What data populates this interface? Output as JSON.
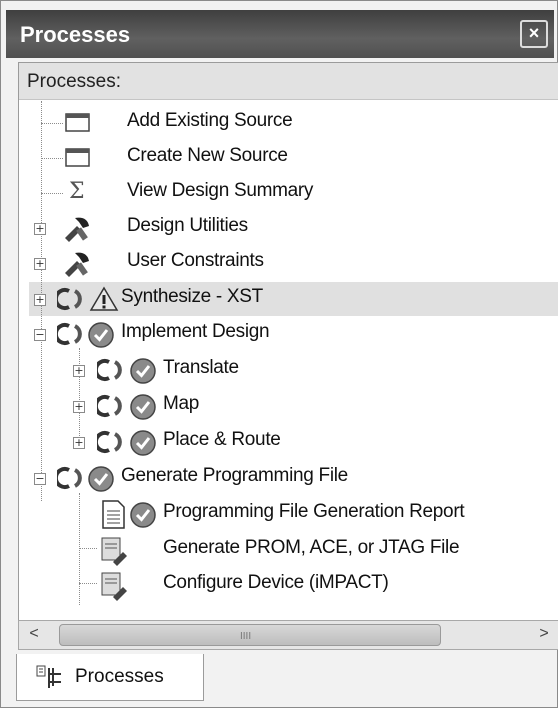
{
  "window": {
    "title": "Processes",
    "close_glyph": "×"
  },
  "panel": {
    "header": "Processes:"
  },
  "items": [
    {
      "label": "Add Existing Source",
      "icon": "window-icon"
    },
    {
      "label": "Create New Source",
      "icon": "window-icon"
    },
    {
      "label": "View Design Summary",
      "icon": "sigma-icon"
    },
    {
      "label": "Design Utilities",
      "icon": "tools-icon"
    },
    {
      "label": "User Constraints",
      "icon": "tools-icon"
    },
    {
      "label": "Synthesize - XST",
      "icon": "warning-icon",
      "selected": true
    },
    {
      "label": "Implement Design",
      "icon": "check-icon"
    },
    {
      "label": "Translate",
      "icon": "check-icon"
    },
    {
      "label": "Map",
      "icon": "check-icon"
    },
    {
      "label": "Place & Route",
      "icon": "check-icon"
    },
    {
      "label": "Generate Programming File",
      "icon": "check-icon"
    },
    {
      "label": "Programming File Generation Report",
      "icon": "report-check-icon"
    },
    {
      "label": "Generate PROM, ACE, or JTAG File",
      "icon": "tools-icon"
    },
    {
      "label": "Configure Device (iMPACT)",
      "icon": "tools-icon"
    }
  ],
  "scrollbar": {
    "left": "<",
    "right": ">",
    "grip": "IIII"
  },
  "tab": {
    "label": "Processes"
  }
}
